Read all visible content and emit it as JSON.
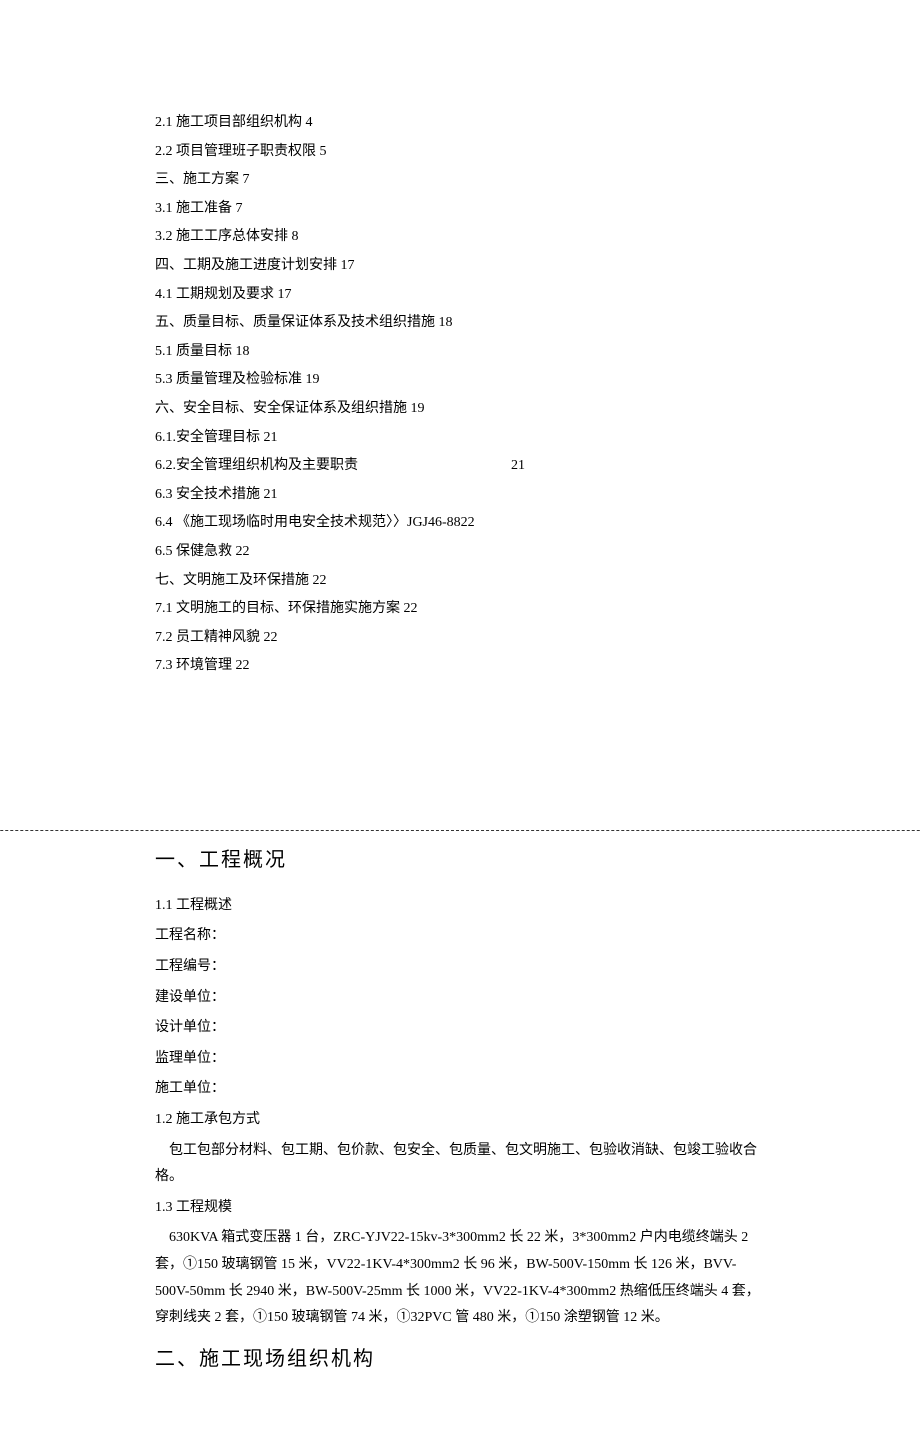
{
  "toc": [
    {
      "text": "2.1  施工项目部组织机构 4"
    },
    {
      "text": "2.2  项目管理班子职责权限 5"
    },
    {
      "text": "三、施工方案 7"
    },
    {
      "text": "3.1  施工准备 7"
    },
    {
      "text": "3.2  施工工序总体安排 8"
    },
    {
      "text": "四、工期及施工进度计划安排 17"
    },
    {
      "text": "4.1 工期规划及要求 17"
    },
    {
      "text": "五、质量目标、质量保证体系及技术组织措施 18"
    },
    {
      "text": "5.1 质量目标 18"
    },
    {
      "text": "5.3 质量管理及检验标准 19"
    },
    {
      "text": "六、安全目标、安全保证体系及组织措施 19"
    },
    {
      "text": "6.1.安全管理目标 21"
    },
    {
      "text": "6.2.安全管理组织机构及主要职责",
      "page": "21",
      "special": true
    },
    {
      "text": "6.3  安全技术措施 21"
    },
    {
      "text": "6.4  《施工现场临时用电安全技术规范〉〉JGJ46-8822"
    },
    {
      "text": "6.5  保健急救 22"
    },
    {
      "text": "七、文明施工及环保措施 22"
    },
    {
      "text": "7.1  文明施工的目标、环保措施实施方案 22"
    },
    {
      "text": "7.2  员工精神风貌 22"
    },
    {
      "text": "7.3  环境管理 22"
    }
  ],
  "h1_section1": "一、工程概况",
  "s1_1_title": "1.1  工程概述",
  "s1_1_fields": [
    "工程名称：",
    "工程编号：",
    "建设单位：",
    "设计单位：",
    "监理单位：",
    "施工单位："
  ],
  "s1_2_title": "1.2  施工承包方式",
  "s1_2_body": "包工包部分材料、包工期、包价款、包安全、包质量、包文明施工、包验收消缺、包竣工验收合格。",
  "s1_3_title": "1.3  工程规模",
  "s1_3_body": "630KVA 箱式变压器 1 台，ZRC-YJV22-15kv-3*300mm2 长 22 米，3*300mm2 户内电缆终端头 2 套，①150 玻璃钢管 15 米，VV22-1KV-4*300mm2 长 96 米，BW-500V-150mm 长 126 米，BVV-500V-50mm 长 2940 米，BW-500V-25mm 长 1000 米，VV22-1KV-4*300mm2 热缩低压终端头 4 套，穿刺线夹 2 套，①150 玻璃钢管 74 米，①32PVC 管 480 米，①150 涂塑钢管 12 米。",
  "h1_section2": "二、施工现场组织机构"
}
